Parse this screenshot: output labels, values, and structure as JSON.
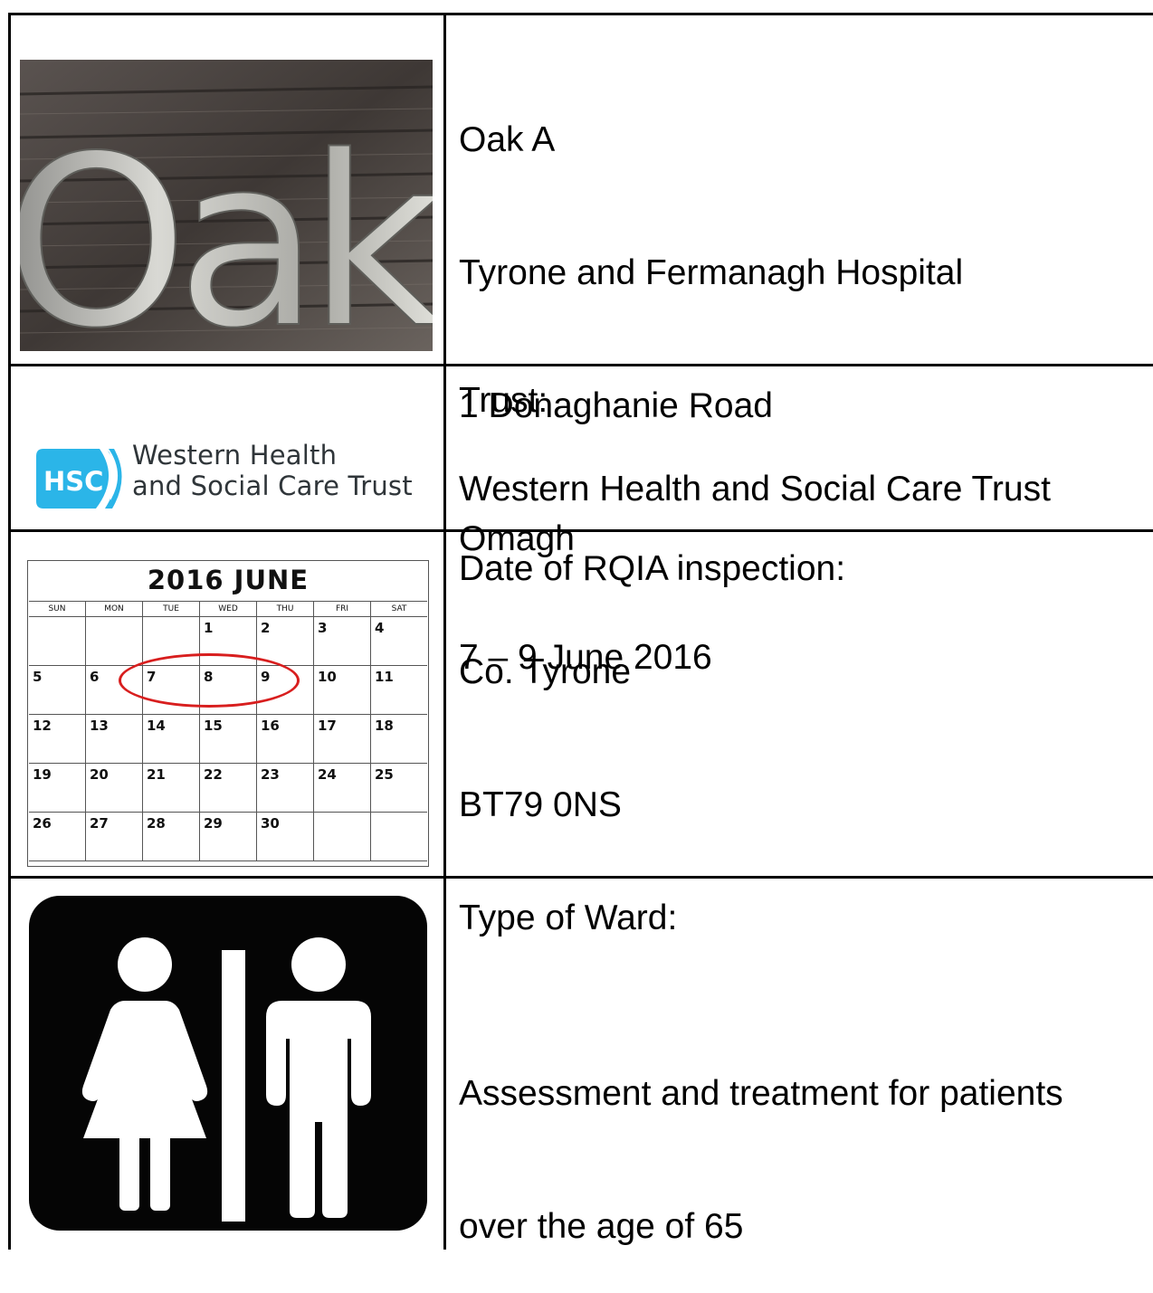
{
  "row1": {
    "photo_caption": "Oak",
    "address_lines": [
      "Oak A",
      "Tyrone and Fermanagh Hospital",
      "1 Donaghanie Road",
      "Omagh",
      "Co. Tyrone",
      "BT79 0NS"
    ]
  },
  "row2": {
    "logo": {
      "badge": "HSC",
      "line1": "Western Health",
      "line2": "and Social Care Trust",
      "color": "#2bb5e8"
    },
    "label": "Trust:",
    "value": "Western Health and Social Care Trust"
  },
  "row3": {
    "calendar": {
      "title": "2016  JUNE",
      "days_of_week": [
        "SUN",
        "MON",
        "TUE",
        "WED",
        "THU",
        "FRI",
        "SAT"
      ],
      "weeks": [
        [
          "",
          "",
          "",
          "1",
          "2",
          "3",
          "4"
        ],
        [
          "5",
          "6",
          "7",
          "8",
          "9",
          "10",
          "11"
        ],
        [
          "12",
          "13",
          "14",
          "15",
          "16",
          "17",
          "18"
        ],
        [
          "19",
          "20",
          "21",
          "22",
          "23",
          "24",
          "25"
        ],
        [
          "26",
          "27",
          "28",
          "29",
          "30",
          "",
          ""
        ]
      ],
      "highlight_color": "#d81e1e"
    },
    "label": "Date of RQIA inspection:",
    "value": "7 – 9 June 2016"
  },
  "row4": {
    "icon": "restroom-sign-icon",
    "label": "Type of Ward:",
    "value_lines": [
      "Assessment and treatment for patients",
      "over the age of 65"
    ]
  }
}
